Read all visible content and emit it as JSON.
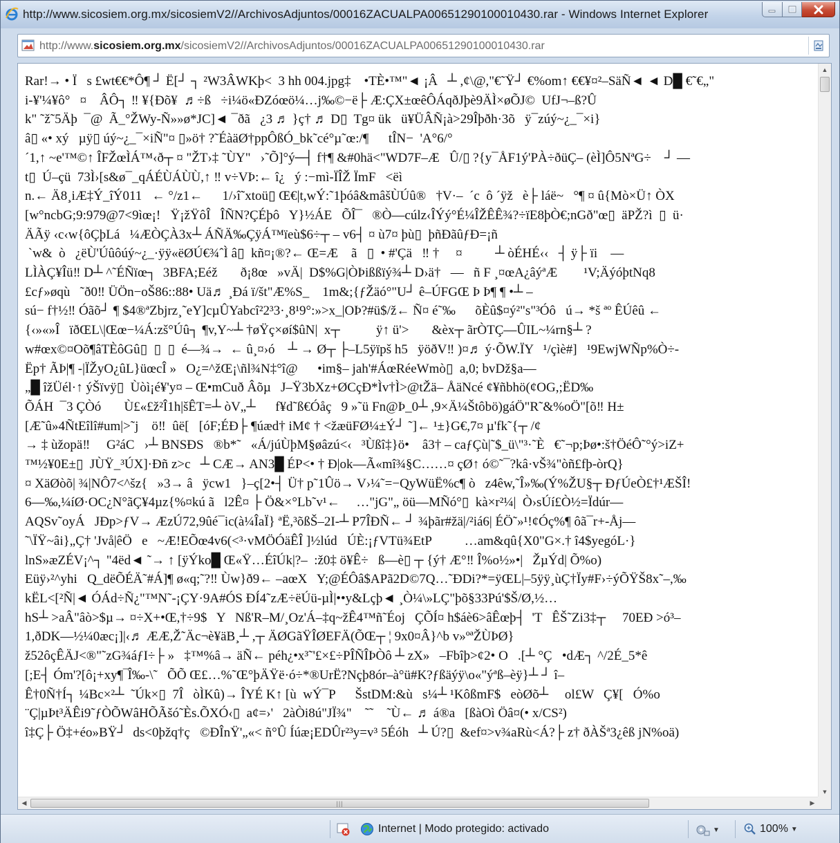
{
  "window": {
    "title": "http://www.sicosiem.org.mx/sicosiemV2//ArchivosAdjuntos/00016ZACUALPA00651290100010430.rar - Windows Internet Explorer"
  },
  "address": {
    "url_prefix": "http://www.",
    "url_domain": "sicosiem.org.mx",
    "url_path": "/sicosiemV2//ArchivosAdjuntos/00016ZACUALPA00651290100010430.rar"
  },
  "content_lines": [
    "Rar!→ • Ï   s £wt€€*Ô¶ ┘ Ë[┘ ┐ ²W3ÂWKþ<  3 hh 004.jpg‡    •TÈ•™\"◄ ¡Â   ┴ ,¢\\@,\"€˜Ÿ┘ €%om↑ €€¥¤²–SäÑ◄ ◄ D█ €˜€„\"",
    "i-¥'¼¥ô°   ¤    ÂÔ┐ ‼ ¥{Ðõ¥  ♬÷ß   ÷i¼ö«ÐZóœö¼…j‰©−ë├ Æ:ÇX±œêÔÁqðJþè9ÄÌ×øÕJ©  UfJ¬–ß?Û",
    "k\" ˜ž˜5Äþ  ¯@  Ã_°ŽWy-Ñ»»ø*JC]◄ ¯ðã   ¿3 ♬ }ç† ♬ D▯  Tg¤ ük   ü¥ÜÂÑ¡à>29Îþðh·3õ   ÿ¯zúý~¿_¯×i}",
    "â▯ «• xý   µÿ▯ úý~¿_¯×iÑ\"¤ ▯»ö† ?˜ÉàäØ†ppÔßÓ_bk˜cé°µ˜œ:/¶      tÎN−  'A°6/°",
    "´1,↑ ~e'™©↑ ÎFŽœÌÁ™‹ð┬ ¤ \"ŽT›‡ ˜ÙY\"   ›˜Õ]°ý─┤ f†¶ &#0hä<\"WD7F–Æ   Û/▯ ?{y¯ÅF1ý'PÀ÷ðüÇ– (èÌ]Ô5NªG÷    ┘ —",
    "t▯  Ú–çü  73Ì›[s&ø¯_qÁÉÙÁÙÙ,↑ ‼ v÷VÞ:← î¿   ý :−mì-ÏÎŽ ÏmF   <ëì",
    "n.← Ä8¸iÆ‡Ý_îÝ011   ← °/z1←      1/›î˜xtoü▯ Œ€|t,wÝ:˜1þóâ&mâšÙÚû®   †V·–  ´c  ô ´ÿž   è├ láë~   °¶ ¤ û{Mò×Ü↑ ÒX",
    "[w°ncbG;9:979@7<9ìœ¡!   Ÿ¡žŸôÎ   ÎÑN?ÇÉþô   Y}½ÁE   ÕÎ¯   ®Ò—cúlz‹ÎÝý°É¼ÎŽÊÊ¾?÷ïE8þÒ€;nGð\"œ▯  äPŽ?ì  ▯  ü·",
    "ÄÃÿ ‹c‹w{ôÇþLá   ¼ÆÒÇÀ3x┴ ÁÑÄ‰ÇÿÁ™ïeù$6÷┬ – v6┤ ¤ ù7¤ þù▯  þñÐãûƒÐ=¡ñ",
    " `w&  ò   ¿ëÙ'Úûôúý~¿_·ÿÿ«ëØÚ€¾ˆÌ â▯  kñ¤¡®?← Œ=Æ    ã   ▯  • #'Çä   ‼ †     ¤          ┴ òÉHÉ‹‹   ┤ ÿ├ ïi    —",
    "LÌÀÇ¥Îü‼ D┴ ^˜ÉÑïœ┐  3BFA;Eéž       ð¡8œ   »vÄ|  D$%G|ÒÞißßïý¾┴ D›ä†   —   ñ F ¸¤œA¿âýªÆ        ¹V;ÄýóþtNq8",
    "£cƒ»øqù   ˜ð0‼ ÜÖn−oŠ86::88• Uä♬ ¸Ðá ï/št\"Æ%S_    1m&;{ƒŽäó°\"U┘ ê–ÚFGŒ Þ Þ¶ ¶ •┴ –",
    "sú− f†½‼ Óãõ┘ ¶ $4®ªZbjrz¸˜eY]cµÛYabcî²2³3·¸8¹9°:»>x_|OÞ?#ü$/ž← Ñ¤ é˜‰      õÈû$¤ý²\"s\"³Óô   ú→ *š ªº ÊÚêû ←",
    "{‹»«»Î   ïðŒL\\|Œœ−¼Á:zš°Úû┐ ¶v,Y~┴ †øŸç×øí$ûN|  x┬           ÿ↑ ü'>       &èx┬ ãrÒTÇ—ÛIL~¼rn§┴ ?",
    "w#œx©¤Oõ¶âTÈôGû▯  ▯  ▯  é—¾→  ← û¸¤›ó    ┴ → Ø┬ ├–L5ÿïpš h5   ÿöðV‼ )¤♬ ý·ÕW.ÏY   ¹/çìè#]   ¹9EwjWÑp%Ò÷-",
    "Ëp† ÃÞ|¶ -|ÏŽyO¿ûL}üœcÎ »   O¿=^žŒ¡\\ñl¾N‡°î@      •im§– jah'#ÁœRéeWmò▯  a,0; bvDž§a—",
    "„█ îžÜél·↑ ýŠïvÿ▯  Ùòì¡é¥'y¤ – Œ•mCuð Âõµ   J–Ÿ3bXz+ØCçÐ*Ìv†Ì>@tŽä– ÅäNcé ¢¥ñbhö(¢OG,;ËD‰",
    "ÕÁH  ¯3 ÇÒó       Ù£«£ž²Î1h|šÊT=┴ òV„┴      f¥d˜ß€Óåç   9 »˜ü Fn@Þ_0┴ ,9×Ä¼Štôbö)gáÖ\"R˜&%oÖ\"[õ‼ H±",
    "[Æ˜û»4ÑtEîlî#um|>˜j    ö‼  ûë[   [óF;ÉÐ├ ¶úæd† iM¢ † <žæüFØ¼±Ý┘ ˜]← ¹±}G€,7¤ µ'fk˜{┬ /¢",
    "→ ‡ ùžopä‼     G²áC   ›┴ BNSÐS   ®b*˜   «Á/júÙþM§øâzú<‹   ³Ùßî‡}ö•    â3† – caƒÇù|˜$_ü\\\"³·˜È   €˜¬p;Þø•:š†ÖéÔ˜°ý>iZ+",
    "™½¥0E±▯  JÙŸ_³ÚX]·Ðñ z>c   ┴ CÆ→ AN3█ ÉP<• † Ð|ok—Ã«mî¾§C……¤ çØ↑ ó©˜¯?kâ·vŠ¾\"òñ£fþ-òrQ}",
    "¤ XäØòõ| ¾|NÔ7<^šz{   »3→ â   ÿcw1   }–ç[2•┤ Ü† p˜1Ûö→ V›¼˜=−QyWüË%c¶ ò   z4êw,˜Î»‰(Ý%ŽU§┬ ÐƒÚeÒ£†¹ÆŠÎ!",
    "6—‰,¼íØ·OC¿N°ãÇ¥4µz{%¤kú ã   l2Ê¤ ├ Ö&×°Lb˜v¹←     …\"jG\"„ öü—MÑó°▯  kà×r²¼|  Ò›sÚí£Ò½=Ïdúr—",
    "AQSv˜oyÁ   JÐp>ƒV→ ÆzÚ72,9ûé¯ic(à¼ÎaÏ} ªË,³õßŠ–2I-┴ P7ÎÐÑ← ┘ ¾þãr#žä|/²iá6| ÉÖ˜»¹!¢Óç%¶ ôã¯r+-Åj—",
    "˜\\ÏŸ~âi}„Ç† 'Jvå|êÖ   e   ~Æ!EÕœ4v6(<³·vMÖÓäÊÎ ]½lúd   ÚÈ:¡ƒVTü¾EtP          …am&qû{X0\"G×.† î4$yegóL·}",
    "lnS»æZÉV¡^┐ \"4ëd◄ ˜→ ↑ [ÿÝko█ Œ«Ÿ…ÉîÚk|?–  :ž0‡ ö¥Ê÷   ß—è▯ ┬ {ý† Æ°‼ Î%o½»•|   ŽµÝd| Õ%o)",
    "Eüÿ›²^yhi   Q_dëÕÉÄ˜#Á]¶ ø«q;˜?‼ Ùw}ð9← –aœX   Y;@ÉÔâ$APã2D©7Q…˜ÐDi?*=ÿŒL|–5ÿÿ¸ùÇ†Ïy#F›÷ýÕŸŠ8x˜–,‰",
    "kËL<[²Ñ|◄ ÓÁd÷Ñ¿\"™N˜-¡ÇY·9A#ÓS ÐÍ4˜zÆ÷ëÚü-µÌ|••y&Lçþ◄ ¸Ò¼\\»LÇ\"þõ§33Pú'$Š/Ø,½…",
    "hS┴ >aÂ\"âò>$µ→ ¤÷X+•Œ,†÷9$   Y   Nß'R–M/¸Oz'Á–‡q~žÊ4™ñ˜Éoj   ÇÕÍ¤ h$áè6>âÊœþ┤  'T   ÊŠ˜Zi3‡┬     70EÐ >ó³–",
    "1,ðDK—½¼0æc¡]|‹♬ ÆÆ,Ž˜Äc¬è¥äB¸┴ ,┬ ÄØGãŸÎØEFÄ(ÕŒ┬ ¦ 9x0¤Â}^b v»ºªŽÙÞØ}",
    "ž52ôçÊÄJ<®\"˜zG¾áƒI÷├ »   ‡™%â→ äÑ← péh¿•x³˜'£×£÷PÎÑÎÞÒô ┴ zX»   –Fbîþ>¢2• O   .[┴ °Ç   •dÆ┐ ^/2É_5*ê",
    "[;E┤ Óm'?[ô¡+xy¶‾Î‰-\\˜   ÕÕ Œ£…%˜Œ°þÄŸë·ó÷*®UrË?Nçþ8ór–à°ü#K?ƒßäýÿ\\o«\"ýªß–èÿ}┴ ┘ î–",
    "Ê†0Ñ†Í┐ ¼Bc×²┴  ˜Úk×▯  7Î   òÌKû)→ ÎYÉ K↑ [ù  wÝ¯P      ŠstDM:&ù   s¼┴ ¹KôßmF$   eòØõ┴     ol£W   Ç¥[   Ó%o",
    "¨Ç|µÞt³ÄÊi9˜ƒÒÕWâHÕÃšó˜Ès.ÕXÓ‹▯  a¢=›'   2àÒi8ú\"JÏ¾\"    ˜˜    ˜Ù← ♬ á®a   [ßàOì Öâ¤(• x/CS²)",
    "î‡Ç├ Ö‡+éo»BŸ┘  ds<0þžq†ç   ©ÐÎnŸ'„«< ñ°Û Íúæ¡EDÛr²³y=v³ 5Éóh   ┴ Ú?▯  &ef¤>v¾aRù<Á?├ z† ðÀŠª3¿êß jN%oä)"
  ],
  "status": {
    "zone_text": "Internet | Modo protegido: activado",
    "zoom": "100%"
  }
}
